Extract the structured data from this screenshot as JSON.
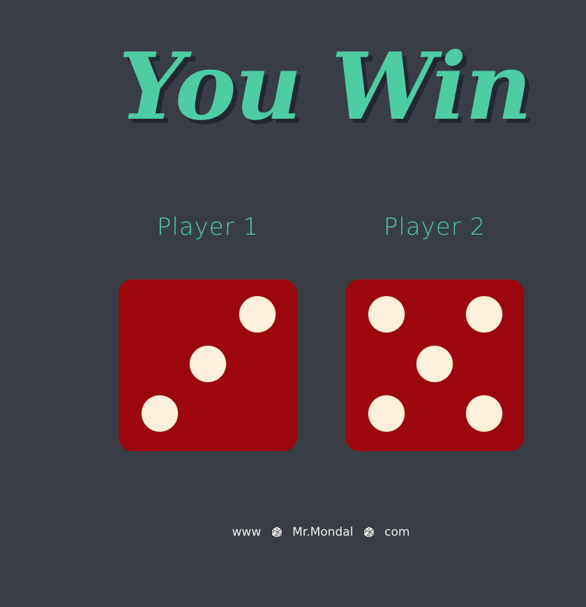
{
  "title": "You Win",
  "players": [
    {
      "label": "Player 1",
      "die_value": 3
    },
    {
      "label": "Player 2",
      "die_value": 5
    }
  ],
  "footer": {
    "part1": "www",
    "part2": "Mr.Mondal",
    "part3": "com",
    "separator_icon": "dice-icon"
  },
  "colors": {
    "background": "#393e46",
    "accent": "#4ecca3",
    "title_shadow": "#222831",
    "die_face": "#9b070c",
    "pip": "#fbf0d9",
    "footer_text": "#eeeeee"
  }
}
